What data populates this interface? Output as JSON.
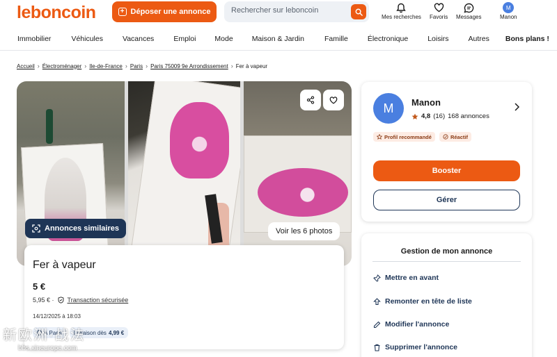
{
  "header": {
    "logo": "leboncoin",
    "deposit_label": "Déposer une annonce",
    "search_placeholder": "Rechercher sur leboncoin",
    "links": {
      "searches": "Mes recherches",
      "favorites": "Favoris",
      "messages": "Messages",
      "account": "Manon",
      "account_initial": "M"
    }
  },
  "categories": [
    "Immobilier",
    "Véhicules",
    "Vacances",
    "Emploi",
    "Mode",
    "Maison & Jardin",
    "Famille",
    "Électronique",
    "Loisirs",
    "Autres",
    "Bons plans !"
  ],
  "breadcrumb": {
    "items": [
      "Accueil",
      "Électroménager",
      "Ile-de-France",
      "Paris",
      "Paris 75009 9e Arrondissement"
    ],
    "current": "Fer à vapeur"
  },
  "gallery": {
    "similar_label": "Annonces similaires",
    "see_photos_label": "Voir les 6 photos"
  },
  "ad": {
    "title": "Fer à vapeur",
    "price": "5 €",
    "total_price": "5,95 € ·",
    "secure_label": "Transaction sécurisée",
    "date": "14/12/2025 à 18:03",
    "tag_location": "À Paris",
    "tag_delivery_prefix": "Livraison dès",
    "tag_delivery_price": "4,99 €"
  },
  "seller": {
    "initial": "M",
    "name": "Manon",
    "rating": "4,8",
    "rating_count": "(16)",
    "ads_count": "168 annonces",
    "badge_recommended": "Profil recommandé",
    "badge_reactive": "Réactif",
    "boost_label": "Booster",
    "manage_label": "Gérer"
  },
  "manage": {
    "title": "Gestion de mon annonce",
    "actions": [
      "Mettre en avant",
      "Remonter en tête de liste",
      "Modifier l'annonce",
      "Supprimer l'annonce"
    ]
  },
  "watermark": {
    "line1": "新欧洲·战法",
    "line2": "bbs.xineurope.com"
  },
  "colors": {
    "brand": "#ec5a13",
    "navy": "#1e3556",
    "avatar": "#4a7fe0"
  }
}
